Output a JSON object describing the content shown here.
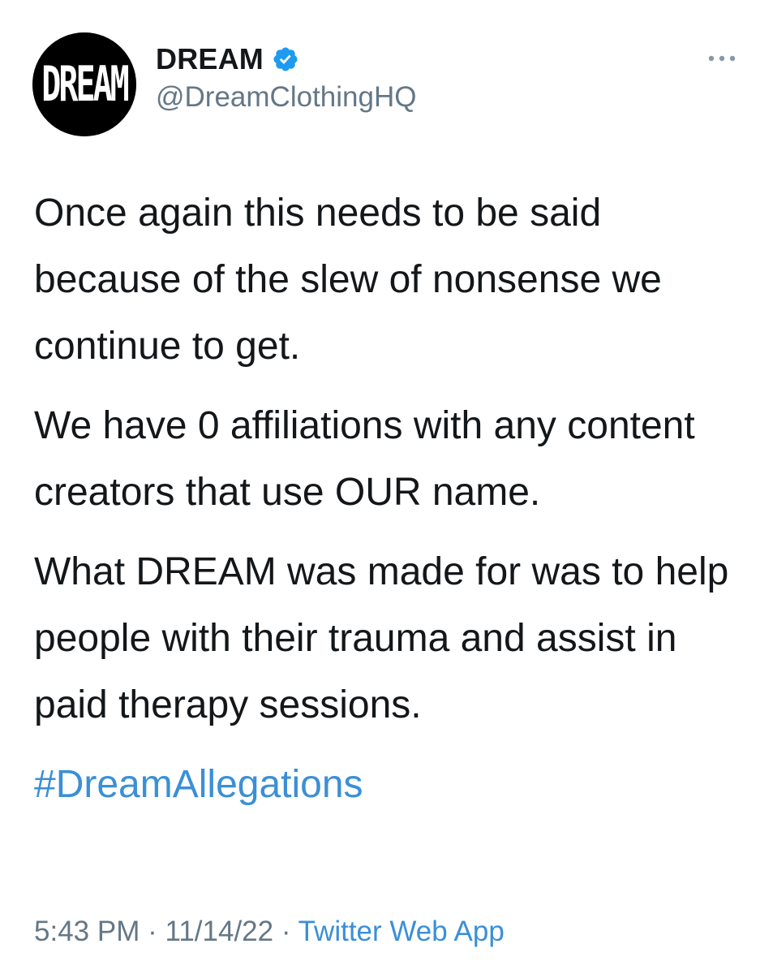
{
  "author": {
    "display_name": "DREAM",
    "handle": "@DreamClothingHQ",
    "avatar_text": "DREAM",
    "verified_icon": "verified-badge-icon",
    "more_icon": "more-options-icon"
  },
  "tweet": {
    "paragraph_1": "Once again this needs to be said because of the slew of nonsense we continue to get.",
    "paragraph_2": "We have 0 affiliations with any content creators that use OUR name.",
    "paragraph_3": "What DREAM was made for was to help people with their trauma and assist in paid therapy sessions.",
    "hashtag": "#DreamAllegations"
  },
  "meta": {
    "time": "5:43 PM",
    "separator": " · ",
    "date": "11/14/22",
    "source": "Twitter Web App"
  },
  "colors": {
    "text": "#14171a",
    "secondary": "#657786",
    "link": "#3b8fd6",
    "verified": "#1d9bf0"
  }
}
